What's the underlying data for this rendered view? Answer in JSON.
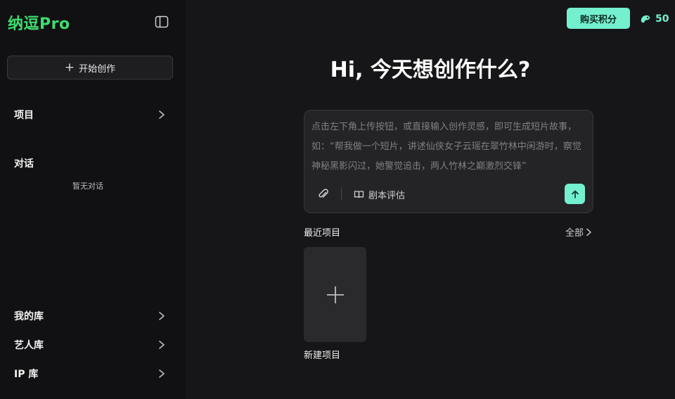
{
  "sidebar": {
    "logo": "纳逗Pro",
    "new_button": "开始创作",
    "items": [
      {
        "label": "项目"
      },
      {
        "label": "我的库"
      },
      {
        "label": "艺人库"
      },
      {
        "label": "IP 库"
      }
    ],
    "chat_section": {
      "title": "对话",
      "empty": "暂无对话"
    }
  },
  "header": {
    "buy_button": "购买积分",
    "credits": "50"
  },
  "main": {
    "headline": "Hi, 今天想创作什么?",
    "composer": {
      "placeholder": "点击左下角上传按钮，或直接输入创作灵感，即可生成短片故事，如：“帮我做一个短片，讲述仙侠女子云瑶在翠竹林中闲游时，察觉神秘黑影闪过，她警觉追击，两人竹林之巅激烈交锋”",
      "eval_button": "剧本评估"
    },
    "recent": {
      "title": "最近项目",
      "all_link": "全部",
      "new_card_label": "新建项目"
    }
  },
  "colors": {
    "brand_green": "#3ddc6f",
    "accent_mint": "#74f0cf",
    "sidebar_bg": "#111113",
    "main_bg": "#161618"
  }
}
